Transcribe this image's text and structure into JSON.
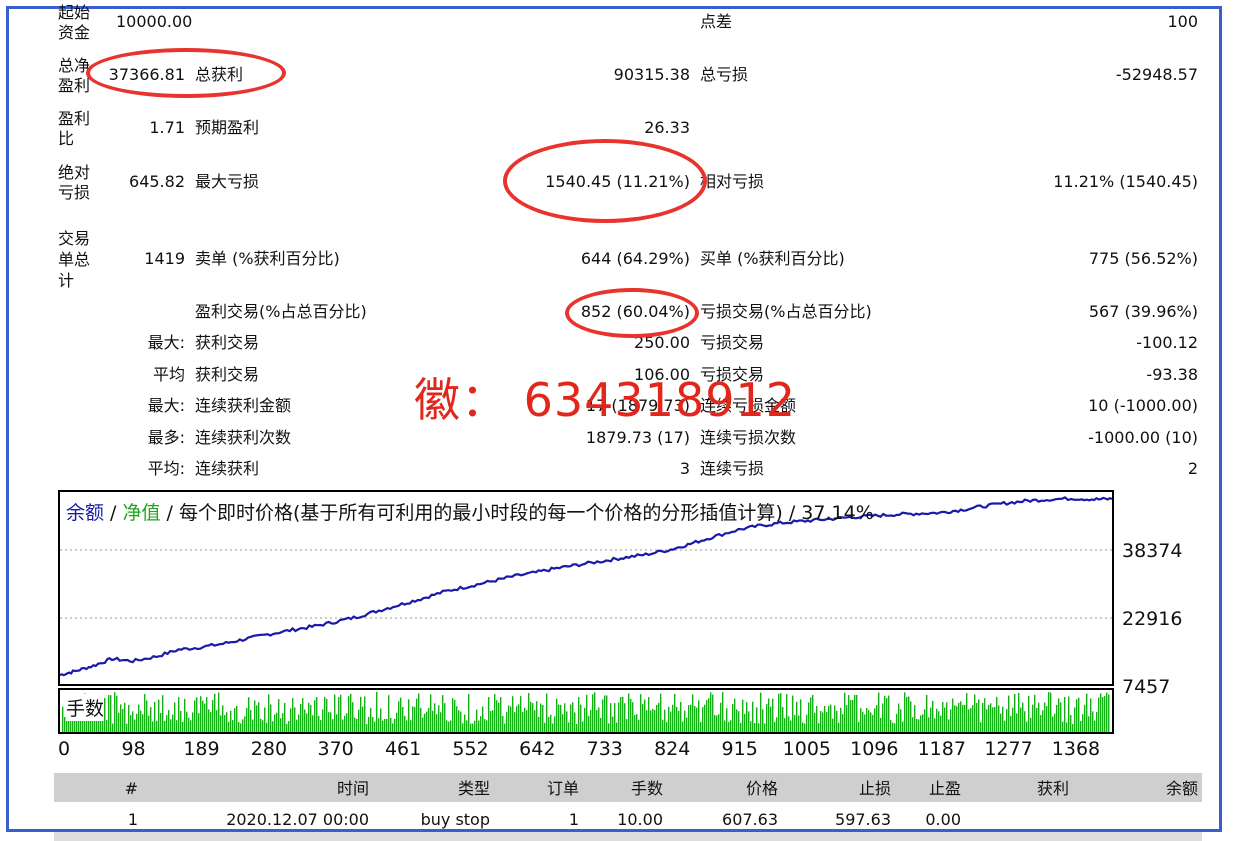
{
  "summary": {
    "initial_deposit_label": "起始资金",
    "initial_deposit_label_l1": "起始",
    "initial_deposit_label_l2": "资金",
    "initial_deposit": "10000.00",
    "spread_label": "点差",
    "spread": "100",
    "net_profit_label_l1": "总净",
    "net_profit_label_l2": "盈利",
    "net_profit": "37366.81",
    "gross_profit_label": "总获利",
    "gross_profit": "90315.38",
    "gross_loss_label": "总亏损",
    "gross_loss": "-52948.57",
    "profit_factor_label_l1": "盈利",
    "profit_factor_label_l2": "比",
    "profit_factor": "1.71",
    "expected_payoff_label": "预期盈利",
    "expected_payoff": "26.33",
    "abs_drawdown_label_l1": "绝对",
    "abs_drawdown_label_l2": "亏损",
    "abs_drawdown": "645.82",
    "max_drawdown_label": "最大亏损",
    "max_drawdown": "1540.45 (11.21%)",
    "rel_drawdown_label": "相对亏损",
    "rel_drawdown": "11.21% (1540.45)",
    "total_trades_label_l1": "交易",
    "total_trades_label_l2": "单总",
    "total_trades_label_l3": "计",
    "total_trades": "1419",
    "short_label": "卖单 (%获利百分比)",
    "short_value": "644 (64.29%)",
    "long_label": "买单 (%获利百分比)",
    "long_value": "775 (56.52%)",
    "profit_trades_label": "盈利交易(%占总百分比)",
    "profit_trades": "852 (60.04%)",
    "loss_trades_label": "亏损交易(%占总百分比)",
    "loss_trades": "567 (39.96%)",
    "largest_prefix": "最大:",
    "largest_profit_label": "获利交易",
    "largest_profit": "250.00",
    "largest_loss_label": "亏损交易",
    "largest_loss": "-100.12",
    "average_prefix": "平均",
    "avg_profit_label": "获利交易",
    "avg_profit": "106.00",
    "avg_loss_label": "亏损交易",
    "avg_loss": "-93.38",
    "max_consec_prefix": "最大:",
    "max_consec_wins_label": "连续获利金额",
    "max_consec_wins": "17 (1879.73)",
    "max_consec_losses_label": "连续亏损金额",
    "max_consec_losses": "10 (-1000.00)",
    "maximal_prefix": "最多:",
    "maximal_consec_profit_label": "连续获利次数",
    "maximal_consec_profit": "1879.73 (17)",
    "maximal_consec_loss_label": "连续亏损次数",
    "maximal_consec_loss": "-1000.00 (10)",
    "avg_consec_prefix": "平均:",
    "avg_consec_wins_label": "连续获利",
    "avg_consec_wins": "3",
    "avg_consec_losses_label": "连续亏损",
    "avg_consec_losses": "2"
  },
  "watermark": "徽： 634318912",
  "chart_data": {
    "type": "line",
    "legend": {
      "balance": "余额",
      "sep1": " / ",
      "equity": "净值",
      "sep2": " / ",
      "desc": "每个即时价格(基于所有可利用的最小时段的每一个价格的分形插值计算) / 37.14%"
    },
    "colors": {
      "balance": "#1a1aa8",
      "equity": "#1aa81a",
      "volume": "#12b012",
      "highlight": "#e8332f"
    },
    "y_ticks": [
      "38374",
      "22916",
      "7457"
    ],
    "x_ticks": [
      "0",
      "98",
      "189",
      "280",
      "370",
      "461",
      "552",
      "642",
      "733",
      "824",
      "915",
      "1005",
      "1096",
      "1187",
      "1277",
      "1368"
    ],
    "volume_label": "手数",
    "xlim": [
      0,
      1419
    ],
    "ylim": [
      7457,
      47500
    ],
    "series": [
      {
        "name": "余额",
        "x": [
          0,
          20,
          45,
          70,
          98,
          130,
          160,
          189,
          220,
          250,
          280,
          310,
          340,
          370,
          400,
          430,
          461,
          490,
          520,
          552,
          580,
          610,
          642,
          670,
          700,
          733,
          760,
          790,
          824,
          850,
          880,
          915,
          945,
          975,
          1005,
          1035,
          1065,
          1096,
          1125,
          1155,
          1187,
          1215,
          1245,
          1277,
          1305,
          1335,
          1368,
          1395,
          1419
        ],
        "y": [
          9000,
          9800,
          11000,
          12500,
          12000,
          13000,
          14500,
          15000,
          15800,
          16800,
          17800,
          18700,
          19500,
          20500,
          21600,
          23000,
          24400,
          25700,
          27200,
          28300,
          29300,
          30400,
          31300,
          32200,
          33000,
          33800,
          34500,
          35200,
          36300,
          37500,
          39000,
          40600,
          41500,
          42100,
          42500,
          42900,
          43300,
          43600,
          43900,
          44100,
          44300,
          44900,
          45700,
          46400,
          46900,
          47200,
          47400,
          47200,
          47300
        ]
      }
    ]
  },
  "trades_table": {
    "headers": [
      "#",
      "时间",
      "类型",
      "订单",
      "手数",
      "价格",
      "止损",
      "止盈",
      "获利",
      "余额"
    ],
    "rows": [
      [
        "1",
        "2020.12.07 00:00",
        "buy stop",
        "1",
        "10.00",
        "607.63",
        "597.63",
        "0.00",
        "",
        ""
      ]
    ]
  }
}
